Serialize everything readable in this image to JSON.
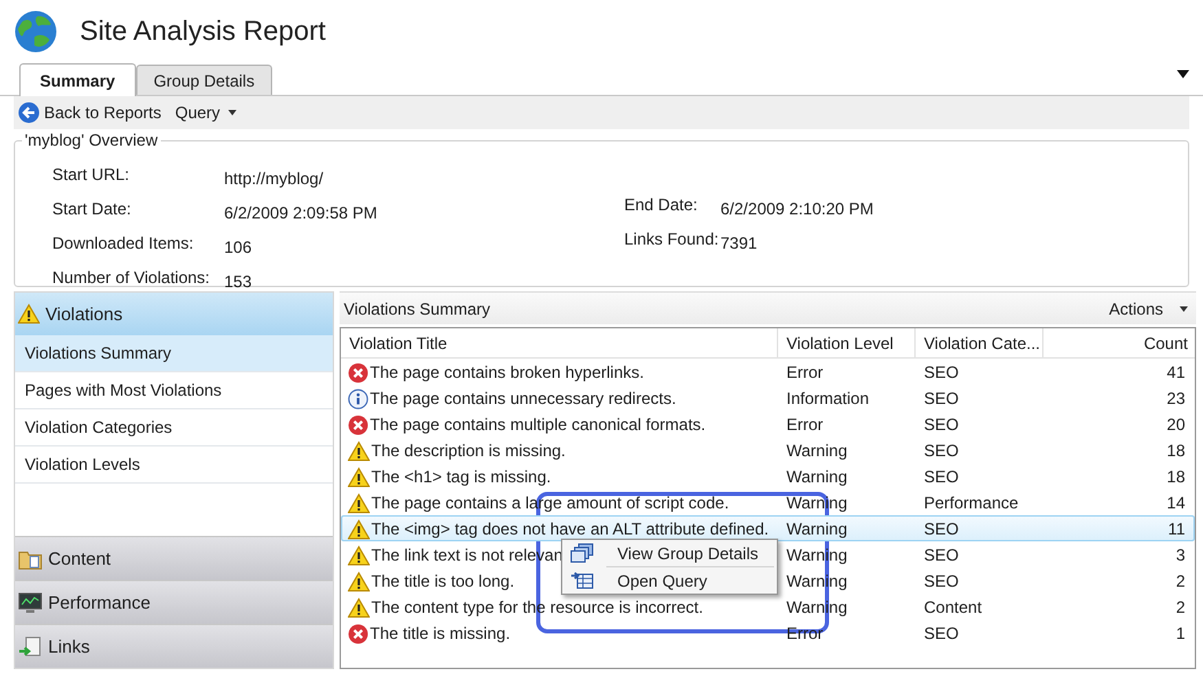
{
  "window": {
    "title": "Site Analysis Report"
  },
  "tabs": [
    {
      "label": "Summary",
      "selected": true
    },
    {
      "label": "Group Details",
      "selected": false
    }
  ],
  "toolbar": {
    "back": "Back to Reports",
    "query": "Query"
  },
  "overview": {
    "title": "'myblog' Overview",
    "left": [
      {
        "label": "Start URL:",
        "value": "http://myblog/"
      },
      {
        "label": "Start Date:",
        "value": "6/2/2009 2:09:58 PM"
      },
      {
        "label": "Downloaded Items:",
        "value": "106"
      },
      {
        "label": "Number of Violations:",
        "value": "153"
      }
    ],
    "right": [
      {
        "label": "End Date:",
        "value": "6/2/2009 2:10:20 PM"
      },
      {
        "label": "Links Found:",
        "value": "7391"
      }
    ]
  },
  "sidebar": {
    "header": "Violations",
    "items": [
      {
        "label": "Violations Summary",
        "selected": true
      },
      {
        "label": "Pages with Most Violations",
        "selected": false
      },
      {
        "label": "Violation Categories",
        "selected": false
      },
      {
        "label": "Violation Levels",
        "selected": false
      }
    ],
    "groups": [
      {
        "label": "Content",
        "kind": "content"
      },
      {
        "label": "Performance",
        "kind": "performance"
      },
      {
        "label": "Links",
        "kind": "links"
      }
    ]
  },
  "panel": {
    "title": "Violations Summary",
    "actions": "Actions"
  },
  "table": {
    "columns": [
      "Violation Title",
      "Violation Level",
      "Violation Cate...",
      "Count"
    ],
    "rows": [
      {
        "kind": "error",
        "title": "The page contains broken hyperlinks.",
        "level": "Error",
        "category": "SEO",
        "count": "41",
        "selected": false
      },
      {
        "kind": "info",
        "title": "The page contains unnecessary redirects.",
        "level": "Information",
        "category": "SEO",
        "count": "23",
        "selected": false
      },
      {
        "kind": "error",
        "title": "The page contains multiple canonical formats.",
        "level": "Error",
        "category": "SEO",
        "count": "20",
        "selected": false
      },
      {
        "kind": "warning",
        "title": "The description is missing.",
        "level": "Warning",
        "category": "SEO",
        "count": "18",
        "selected": false
      },
      {
        "kind": "warning",
        "title": "The <h1> tag is missing.",
        "level": "Warning",
        "category": "SEO",
        "count": "18",
        "selected": false
      },
      {
        "kind": "warning",
        "title": "The page contains a large amount of script code.",
        "level": "Warning",
        "category": "Performance",
        "count": "14",
        "selected": false
      },
      {
        "kind": "warning",
        "title": "The <img> tag does not have an ALT attribute defined.",
        "level": "Warning",
        "category": "SEO",
        "count": "11",
        "selected": true
      },
      {
        "kind": "warning",
        "title": "The link text is not relevan",
        "level": "Warning",
        "category": "SEO",
        "count": "3",
        "selected": false
      },
      {
        "kind": "warning",
        "title": "The title is too long.",
        "level": "Warning",
        "category": "SEO",
        "count": "2",
        "selected": false
      },
      {
        "kind": "warning",
        "title": "The content type for the resource is incorrect.",
        "level": "Warning",
        "category": "Content",
        "count": "2",
        "selected": false
      },
      {
        "kind": "error",
        "title": "The title is missing.",
        "level": "Error",
        "category": "SEO",
        "count": "1",
        "selected": false
      }
    ]
  },
  "context_menu": {
    "items": [
      {
        "label": "View Group Details",
        "kind": "view"
      },
      {
        "label": "Open Query",
        "kind": "query"
      }
    ]
  }
}
